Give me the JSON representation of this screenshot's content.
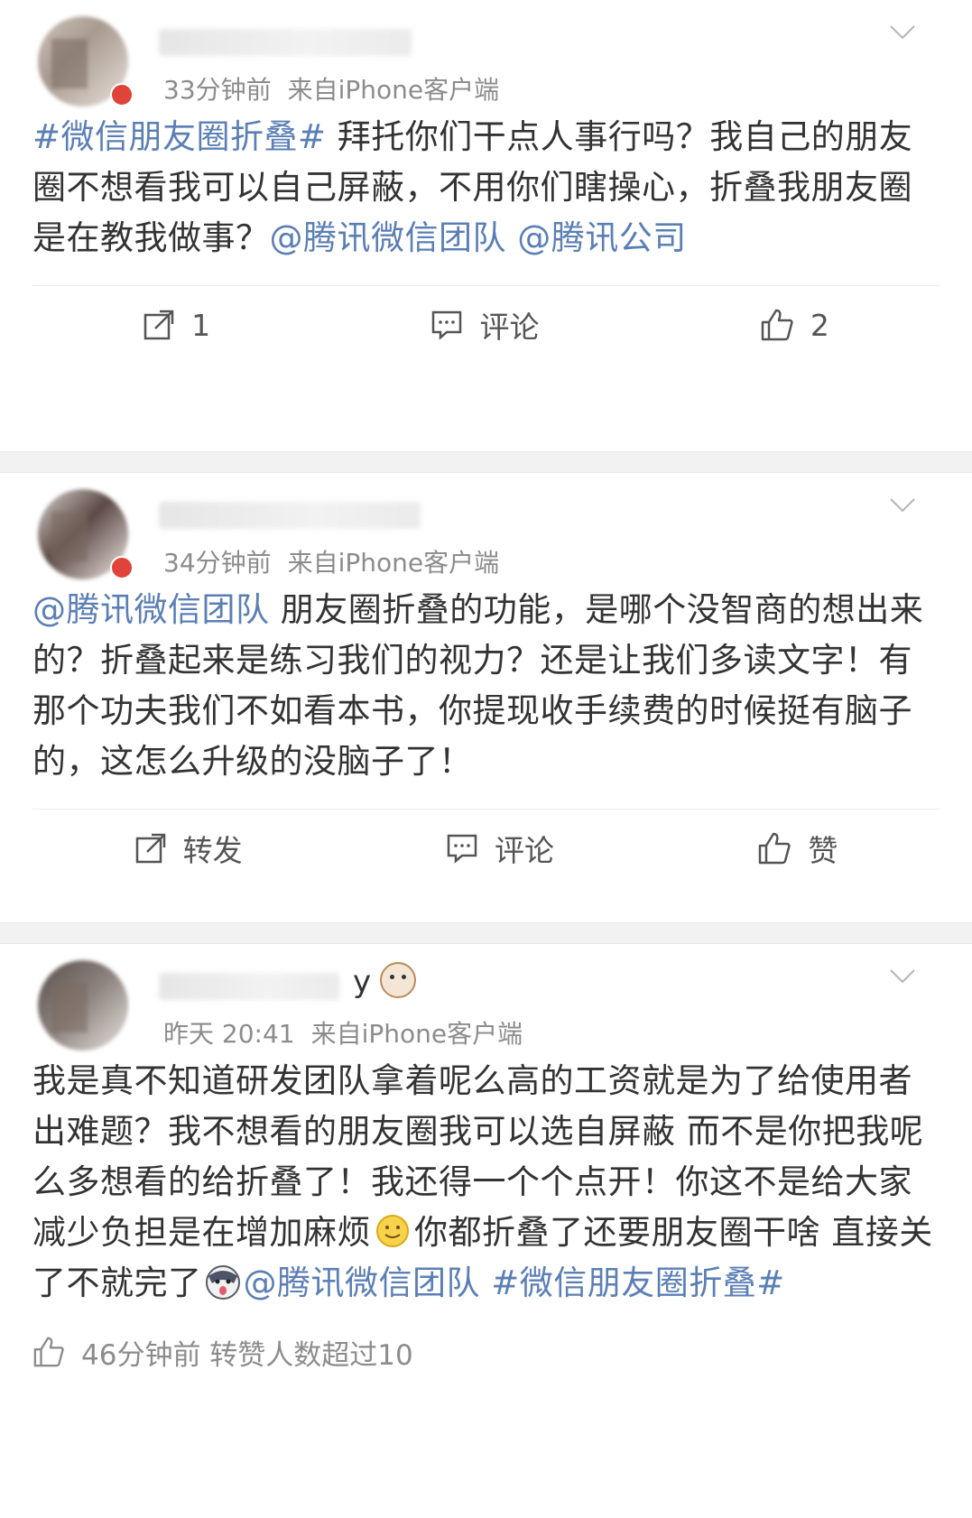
{
  "posts": [
    {
      "meta_time": "33分钟前",
      "meta_source": "来自iPhone客户端",
      "content": [
        {
          "type": "link",
          "text": "#微信朋友圈折叠#"
        },
        {
          "type": "text",
          "text": " 拜托你们干点人事行吗？我自己的朋友圈不想看我可以自己屏蔽，不用你们瞎操心，折叠我朋友圈是在教我做事？"
        },
        {
          "type": "link",
          "text": "@腾讯微信团队"
        },
        {
          "type": "text",
          "text": " "
        },
        {
          "type": "link",
          "text": "@腾讯公司"
        }
      ],
      "actions": {
        "repost": "1",
        "comment": "评论",
        "like": "2"
      }
    },
    {
      "meta_time": "34分钟前",
      "meta_source": "来自iPhone客户端",
      "content": [
        {
          "type": "link",
          "text": "@腾讯微信团队"
        },
        {
          "type": "text",
          "text": " 朋友圈折叠的功能，是哪个没智商的想出来的？折叠起来是练习我们的视力？还是让我们多读文字！有那个功夫我们不如看本书，你提现收手续费的时候挺有脑子的，这怎么升级的没脑子了！"
        }
      ],
      "actions": {
        "repost": "转发",
        "comment": "评论",
        "like": "赞"
      }
    },
    {
      "name_tail": "y",
      "meta_time": "昨天 20:41",
      "meta_source": "来自iPhone客户端",
      "content_part1": "我是真不知道研发团队拿着呢么高的工资就是为了给使用者出难题？我不想看的朋友圈我可以选自屏蔽 而不是你把我呢么多想看的给折叠了！我还得一个个点开！你这不是给大家减少负担是在增加麻烦",
      "content_part2": "你都折叠了还要朋友圈干啥 直接关了不就完了",
      "mention": "@腾讯微信团队",
      "hashtag": "#微信朋友圈折叠#",
      "footer": "46分钟前 转赞人数超过10"
    }
  ]
}
